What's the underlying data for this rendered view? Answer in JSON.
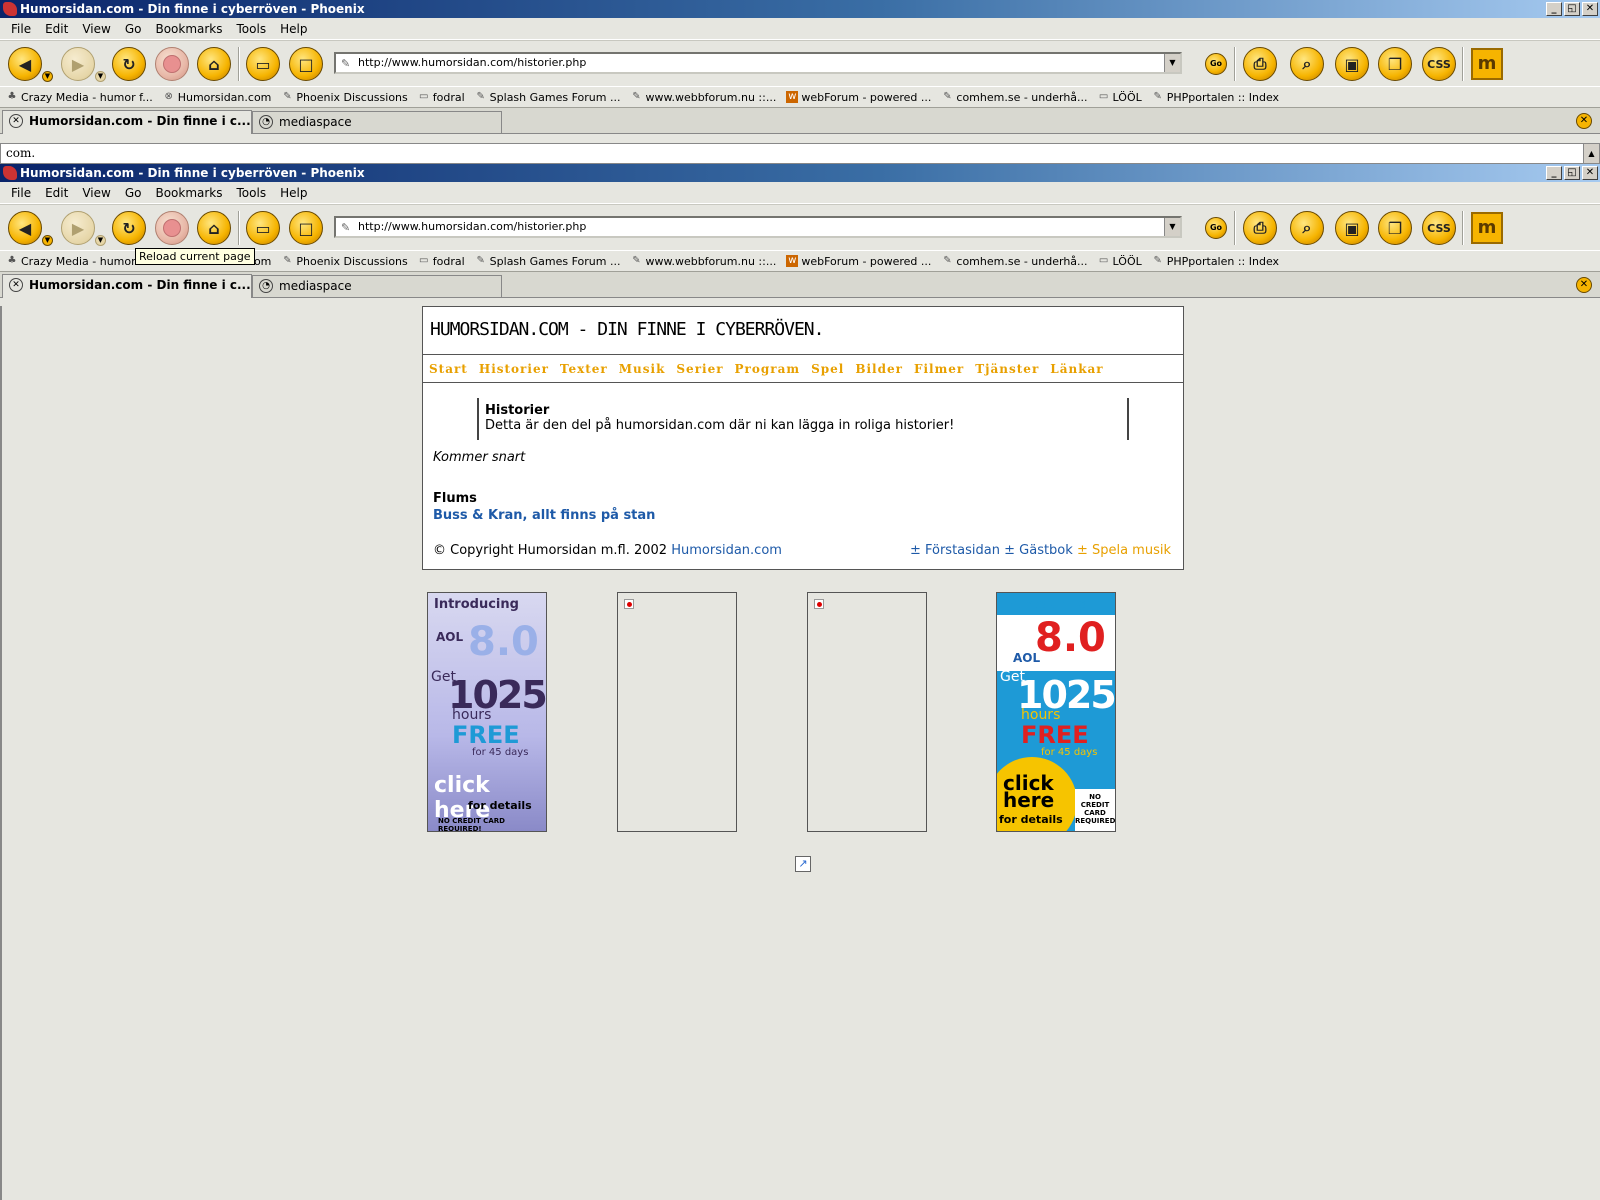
{
  "window": {
    "title": "Humorsidan.com - Din finne i cyberröven - Phoenix",
    "controls": [
      "_",
      "◱",
      "✕"
    ]
  },
  "menu": [
    "File",
    "Edit",
    "View",
    "Go",
    "Bookmarks",
    "Tools",
    "Help"
  ],
  "toolbar": {
    "url": "http://www.humorsidan.com/historier.php",
    "go_label": "Go",
    "css_label": "CSS",
    "m_label": "m",
    "tooltip": "Reload current page"
  },
  "bookmarks": [
    {
      "label": "Crazy Media - humor f...",
      "icon": "site-icon"
    },
    {
      "label": "Humorsidan.com",
      "icon": "site-icon"
    },
    {
      "label": "Phoenix Discussions",
      "icon": "page-icon"
    },
    {
      "label": "fodral",
      "icon": "folder-icon"
    },
    {
      "label": "Splash Games Forum ...",
      "icon": "page-icon"
    },
    {
      "label": "www.webbforum.nu ::...",
      "icon": "page-icon"
    },
    {
      "label": "webForum - powered ...",
      "icon": "site-icon"
    },
    {
      "label": "comhem.se - underhå...",
      "icon": "page-icon"
    },
    {
      "label": "LÖÖL",
      "icon": "folder-icon"
    },
    {
      "label": "PHPportalen :: Index",
      "icon": "page-icon"
    }
  ],
  "tabs": [
    {
      "label": "Humorsidan.com - Din finne i c...",
      "active": true
    },
    {
      "label": "mediaspace",
      "active": false
    }
  ],
  "strip_text": "com.",
  "site": {
    "header": "HUMORSIDAN.COM - DIN FINNE I CYBERRÖVEN.",
    "nav": [
      "Start",
      "Historier",
      "Texter",
      "Musik",
      "Serier",
      "Program",
      "Spel",
      "Bilder",
      "Filmer",
      "Tjänster",
      "Länkar"
    ],
    "intro_heading": "Historier",
    "intro_text": "Detta är den del på humorsidan.com där ni kan lägga in roliga historier!",
    "coming_soon": "Kommer snart",
    "section_heading": "Flums",
    "section_link": "Buss & Kran, allt finns på stan",
    "footer_copyright": "© Copyright Humorsidan m.fl. 2002",
    "footer_site_link": "Humorsidan.com",
    "footer_link_start": "± Förstasidan",
    "footer_link_guestbook": "± Gästbok",
    "footer_link_music": "± Spela musik"
  },
  "ads": {
    "introducing": "Introducing",
    "aol": "AOL",
    "version": "8.0",
    "get": "Get",
    "hours_num": "1025",
    "hours": "hours",
    "free": "FREE",
    "days": "for 45 days",
    "click": "click here",
    "details": "for details",
    "no_cc": "NO CREDIT CARD REQUIRED!",
    "no_cc2": "NO CREDIT CARD REQUIRED"
  }
}
